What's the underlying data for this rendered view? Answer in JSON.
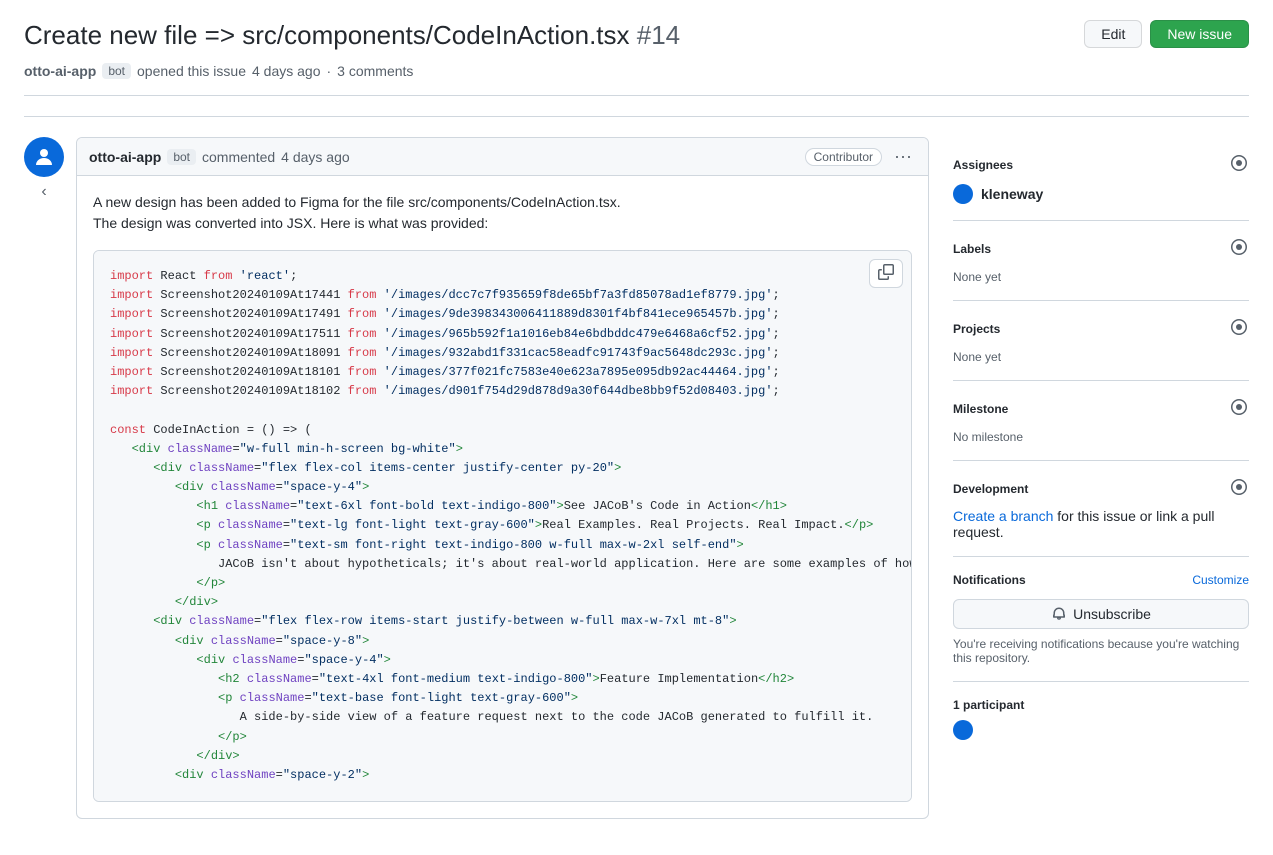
{
  "header": {
    "title": "Create new file => src/components/CodeInAction.tsx",
    "issue_number": "#14",
    "edit_label": "Edit",
    "new_issue_label": "New issue"
  },
  "issue_meta": {
    "author": "otto-ai-app",
    "author_badge": "bot",
    "action": "opened this issue",
    "time": "4 days ago",
    "comment_count": "3 comments"
  },
  "comment": {
    "author": "otto-ai-app",
    "author_badge": "bot",
    "action": "commented",
    "time": "4 days ago",
    "contributor_label": "Contributor",
    "text_line1": "A new design has been added to Figma for the file src/components/CodeInAction.tsx.",
    "text_line2": "The design was converted into JSX. Here is what was provided:"
  },
  "code": {
    "lines": [
      {
        "type": "import",
        "text": "import React from 'react';"
      },
      {
        "type": "import_img",
        "keyword": "import",
        "name": "Screenshot20240109At17441",
        "from": "from",
        "path": "'/images/dcc7c7f935659f8de65bf7a3fd85078ad1ef8779.jpg';"
      },
      {
        "type": "import_img",
        "keyword": "import",
        "name": "Screenshot20240109At17491",
        "from": "from",
        "path": "'/images/9de398343006411889d8301f4bf841ece965457b.jpg';"
      },
      {
        "type": "import_img",
        "keyword": "import",
        "name": "Screenshot20240109At17511",
        "from": "from",
        "path": "'/images/965b592f1a1016eb84e6bdbddc479e6468a6cf52.jpg';"
      },
      {
        "type": "import_img",
        "keyword": "import",
        "name": "Screenshot20240109At18091",
        "from": "from",
        "path": "'/images/932abd1f331cac58eadfc91743f9ac5648dc293c.jpg';"
      },
      {
        "type": "import_img",
        "keyword": "import",
        "name": "Screenshot20240109At18101",
        "from": "from",
        "path": "'/images/377f021fc7583e40e623a7895e095db92ac44464.jpg';"
      },
      {
        "type": "import_img",
        "keyword": "import",
        "name": "Screenshot20240109At18102",
        "from": "from",
        "path": "'/images/d901f754d29d878d9a30f644dbe8bb9f52d08403.jpg';"
      },
      {
        "type": "blank"
      },
      {
        "type": "const",
        "text": "const CodeInAction = () => ("
      },
      {
        "type": "jsx",
        "text": "   <div className=\"w-full min-h-screen bg-white\">"
      },
      {
        "type": "jsx",
        "text": "      <div className=\"flex flex-col items-center justify-center py-20\">"
      },
      {
        "type": "jsx",
        "text": "         <div className=\"space-y-4\">"
      },
      {
        "type": "jsx",
        "text": "            <h1 className=\"text-6xl font-bold text-indigo-800\">See JACoB's Code in Action</h1>"
      },
      {
        "type": "jsx",
        "text": "            <p className=\"text-lg font-light text-gray-600\">Real Examples. Real Projects. Real Impact.</p>"
      },
      {
        "type": "jsx",
        "text": "            <p className=\"text-sm font-right text-indigo-800 w-full max-w-2xl self-end\">"
      },
      {
        "type": "jsx",
        "text": "               JACoB isn't about hypotheticals; it's about real-world application. Here are some examples of how JA..."
      },
      {
        "type": "jsx",
        "text": "            </p>"
      },
      {
        "type": "jsx",
        "text": "         </div>"
      },
      {
        "type": "jsx",
        "text": "      <div className=\"flex flex-row items-start justify-between w-full max-w-7xl mt-8\">"
      },
      {
        "type": "jsx",
        "text": "         <div className=\"space-y-8\">"
      },
      {
        "type": "jsx",
        "text": "            <div className=\"space-y-4\">"
      },
      {
        "type": "jsx",
        "text": "               <h2 className=\"text-4xl font-medium text-indigo-800\">Feature Implementation</h2>"
      },
      {
        "type": "jsx",
        "text": "               <p className=\"text-base font-light text-gray-600\">"
      },
      {
        "type": "jsx",
        "text": "                  A side-by-side view of a feature request next to the code JACoB generated to fulfill it."
      },
      {
        "type": "jsx",
        "text": "               </p>"
      },
      {
        "type": "jsx",
        "text": "            </div>"
      },
      {
        "type": "jsx",
        "text": "         <div className=\"space-y-2\">"
      }
    ]
  },
  "sidebar": {
    "assignees_title": "Assignees",
    "assignee_name": "kleneway",
    "labels_title": "Labels",
    "labels_value": "None yet",
    "projects_title": "Projects",
    "projects_value": "None yet",
    "milestone_title": "Milestone",
    "milestone_value": "No milestone",
    "development_title": "Development",
    "development_link": "Create a branch",
    "development_text": " for this issue or link a pull request.",
    "notifications_title": "Notifications",
    "customize_label": "Customize",
    "unsubscribe_label": "Unsubscribe",
    "notification_desc": "You're receiving notifications because you're watching this repository.",
    "participants_title": "1 participant"
  }
}
